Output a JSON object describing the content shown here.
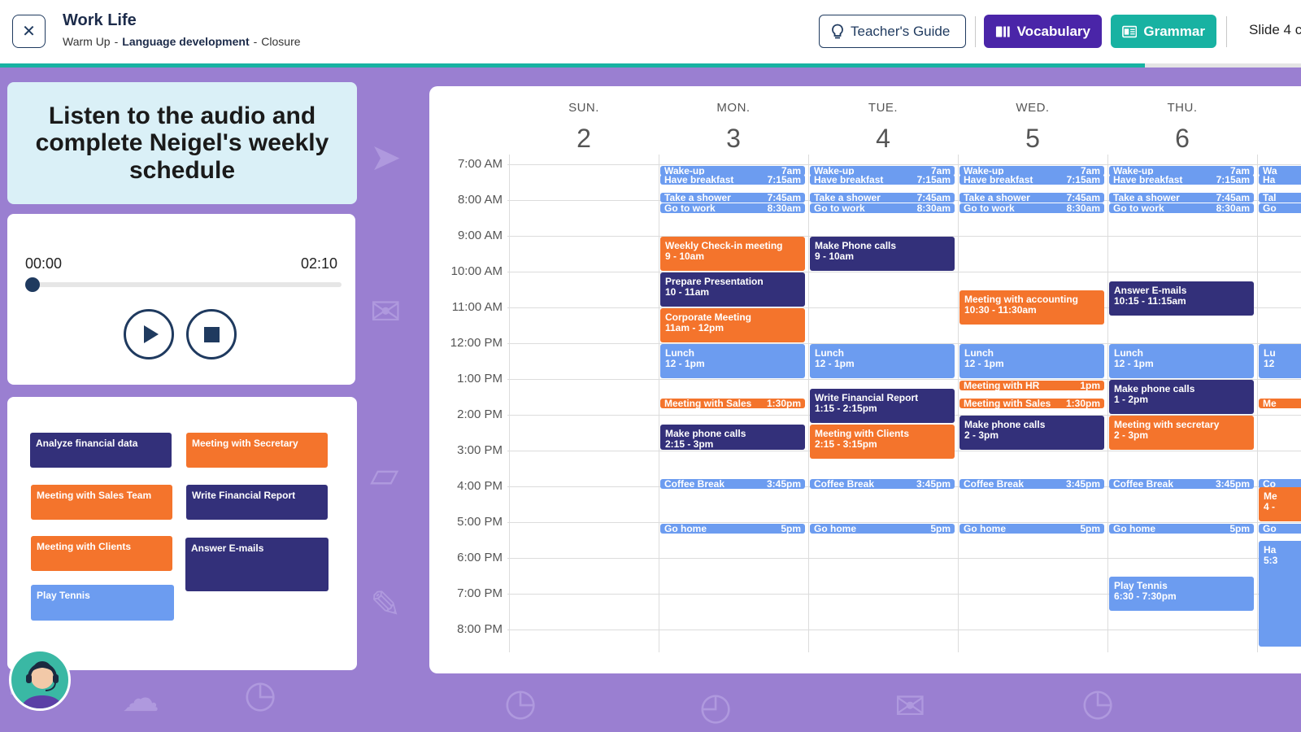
{
  "header": {
    "title": "Work Life",
    "breadcrumb": [
      "Warm Up",
      "Language development",
      "Closure"
    ],
    "teachers_guide_label": "Teacher's Guide",
    "vocabulary_label": "Vocabulary",
    "grammar_label": "Grammar",
    "slide_label": "Slide 4 c",
    "progress_fraction": 0.88
  },
  "instructions": "Listen to the audio and complete Neigel's weekly schedule",
  "player": {
    "current_time": "00:00",
    "total_time": "02:10"
  },
  "word_bank": [
    {
      "label": "Analyze financial data",
      "color": "navy"
    },
    {
      "label": "Meeting with Secretary",
      "color": "orange"
    },
    {
      "label": "Meeting with Sales Team",
      "color": "orange"
    },
    {
      "label": "Write Financial Report",
      "color": "navy"
    },
    {
      "label": "Meeting with Clients",
      "color": "orange"
    },
    {
      "label": "Answer E-mails",
      "color": "navy"
    },
    {
      "label": "Play Tennis",
      "color": "blue"
    }
  ],
  "calendar": {
    "days": [
      {
        "name": "SUN.",
        "date": "2"
      },
      {
        "name": "MON.",
        "date": "3"
      },
      {
        "name": "TUE.",
        "date": "4"
      },
      {
        "name": "WED.",
        "date": "5"
      },
      {
        "name": "THU.",
        "date": "6"
      },
      {
        "name": "",
        "date": ""
      }
    ],
    "hours": [
      "7:00 AM",
      "8:00 AM",
      "9:00 AM",
      "10:00 AM",
      "11:00 AM",
      "12:00 PM",
      "1:00 PM",
      "2:00 PM",
      "3:00 PM",
      "4:00 PM",
      "5:00 PM",
      "6:00 PM",
      "7:00 PM",
      "8:00 PM"
    ],
    "events": [
      {
        "day": 1,
        "title": "Wake-up",
        "time": "7am",
        "start": 7.0,
        "kind": "small",
        "color": "blue"
      },
      {
        "day": 1,
        "title": "Have breakfast",
        "time": "7:15am",
        "start": 7.25,
        "kind": "small",
        "color": "blue"
      },
      {
        "day": 1,
        "title": "Take a shower",
        "time": "7:45am",
        "start": 7.75,
        "kind": "small",
        "color": "blue"
      },
      {
        "day": 1,
        "title": "Go to work",
        "time": "8:30am",
        "start": 8.05,
        "kind": "small",
        "color": "blue"
      },
      {
        "day": 1,
        "title": "Weekly Check-in meeting",
        "time": "9 - 10am",
        "start": 9.0,
        "end": 10.0,
        "kind": "block",
        "color": "orange"
      },
      {
        "day": 1,
        "title": "Prepare Presentation",
        "time": "10 - 11am",
        "start": 10.0,
        "end": 11.0,
        "kind": "block",
        "color": "navy"
      },
      {
        "day": 1,
        "title": "Corporate Meeting",
        "time": "11am - 12pm",
        "start": 11.0,
        "end": 12.0,
        "kind": "block",
        "color": "orange"
      },
      {
        "day": 1,
        "title": "Lunch",
        "time": "12 - 1pm",
        "start": 12.0,
        "end": 13.0,
        "kind": "block",
        "color": "blue"
      },
      {
        "day": 1,
        "title": "Meeting with Sales",
        "time": "1:30pm",
        "start": 13.5,
        "kind": "small",
        "color": "orange"
      },
      {
        "day": 1,
        "title": "Make phone calls",
        "time": "2:15 - 3pm",
        "start": 14.25,
        "end": 15.0,
        "kind": "block",
        "color": "navy"
      },
      {
        "day": 1,
        "title": "Coffee Break",
        "time": "3:45pm",
        "start": 15.75,
        "kind": "small",
        "color": "blue"
      },
      {
        "day": 1,
        "title": "Go home",
        "time": "5pm",
        "start": 17.0,
        "kind": "small",
        "color": "blue"
      },
      {
        "day": 2,
        "title": "Wake-up",
        "time": "7am",
        "start": 7.0,
        "kind": "small",
        "color": "blue"
      },
      {
        "day": 2,
        "title": "Have breakfast",
        "time": "7:15am",
        "start": 7.25,
        "kind": "small",
        "color": "blue"
      },
      {
        "day": 2,
        "title": "Take a shower",
        "time": "7:45am",
        "start": 7.75,
        "kind": "small",
        "color": "blue"
      },
      {
        "day": 2,
        "title": "Go to work",
        "time": "8:30am",
        "start": 8.05,
        "kind": "small",
        "color": "blue"
      },
      {
        "day": 2,
        "title": "Make Phone calls",
        "time": "9 - 10am",
        "start": 9.0,
        "end": 10.0,
        "kind": "block",
        "color": "navy"
      },
      {
        "day": 2,
        "title": "Lunch",
        "time": "12 - 1pm",
        "start": 12.0,
        "end": 13.0,
        "kind": "block",
        "color": "blue"
      },
      {
        "day": 2,
        "title": "Write Financial Report",
        "time": "1:15 - 2:15pm",
        "start": 13.25,
        "end": 14.25,
        "kind": "block",
        "color": "navy"
      },
      {
        "day": 2,
        "title": "Meeting with Clients",
        "time": "2:15 - 3:15pm",
        "start": 14.25,
        "end": 15.25,
        "kind": "block",
        "color": "orange"
      },
      {
        "day": 2,
        "title": "Coffee Break",
        "time": "3:45pm",
        "start": 15.75,
        "kind": "small",
        "color": "blue"
      },
      {
        "day": 2,
        "title": "Go home",
        "time": "5pm",
        "start": 17.0,
        "kind": "small",
        "color": "blue"
      },
      {
        "day": 3,
        "title": "Wake-up",
        "time": "7am",
        "start": 7.0,
        "kind": "small",
        "color": "blue"
      },
      {
        "day": 3,
        "title": "Have breakfast",
        "time": "7:15am",
        "start": 7.25,
        "kind": "small",
        "color": "blue"
      },
      {
        "day": 3,
        "title": "Take a shower",
        "time": "7:45am",
        "start": 7.75,
        "kind": "small",
        "color": "blue"
      },
      {
        "day": 3,
        "title": "Go to work",
        "time": "8:30am",
        "start": 8.05,
        "kind": "small",
        "color": "blue"
      },
      {
        "day": 3,
        "title": "Meeting with accounting",
        "time": "10:30 - 11:30am",
        "start": 10.5,
        "end": 11.5,
        "kind": "block",
        "color": "orange"
      },
      {
        "day": 3,
        "title": "Lunch",
        "time": "12 - 1pm",
        "start": 12.0,
        "end": 13.0,
        "kind": "block",
        "color": "blue"
      },
      {
        "day": 3,
        "title": "Meeting with HR",
        "time": "1pm",
        "start": 13.0,
        "kind": "small",
        "color": "orange"
      },
      {
        "day": 3,
        "title": "Meeting with Sales",
        "time": "1:30pm",
        "start": 13.5,
        "kind": "small",
        "color": "orange"
      },
      {
        "day": 3,
        "title": "Make phone calls",
        "time": "2 - 3pm",
        "start": 14.0,
        "end": 15.0,
        "kind": "block",
        "color": "navy"
      },
      {
        "day": 3,
        "title": "Coffee Break",
        "time": "3:45pm",
        "start": 15.75,
        "kind": "small",
        "color": "blue"
      },
      {
        "day": 3,
        "title": "Go home",
        "time": "5pm",
        "start": 17.0,
        "kind": "small",
        "color": "blue"
      },
      {
        "day": 4,
        "title": "Wake-up",
        "time": "7am",
        "start": 7.0,
        "kind": "small",
        "color": "blue"
      },
      {
        "day": 4,
        "title": "Have breakfast",
        "time": "7:15am",
        "start": 7.25,
        "kind": "small",
        "color": "blue"
      },
      {
        "day": 4,
        "title": "Take a shower",
        "time": "7:45am",
        "start": 7.75,
        "kind": "small",
        "color": "blue"
      },
      {
        "day": 4,
        "title": "Go to work",
        "time": "8:30am",
        "start": 8.05,
        "kind": "small",
        "color": "blue"
      },
      {
        "day": 4,
        "title": "Answer E-mails",
        "time": "10:15 - 11:15am",
        "start": 10.25,
        "end": 11.25,
        "kind": "block",
        "color": "navy"
      },
      {
        "day": 4,
        "title": "Lunch",
        "time": "12 - 1pm",
        "start": 12.0,
        "end": 13.0,
        "kind": "block",
        "color": "blue"
      },
      {
        "day": 4,
        "title": "Make phone calls",
        "time": "1 - 2pm",
        "start": 13.0,
        "end": 14.0,
        "kind": "block",
        "color": "navy"
      },
      {
        "day": 4,
        "title": "Meeting with secretary",
        "time": "2 - 3pm",
        "start": 14.0,
        "end": 15.0,
        "kind": "block",
        "color": "orange"
      },
      {
        "day": 4,
        "title": "Coffee Break",
        "time": "3:45pm",
        "start": 15.75,
        "kind": "small",
        "color": "blue"
      },
      {
        "day": 4,
        "title": "Go home",
        "time": "5pm",
        "start": 17.0,
        "kind": "small",
        "color": "blue"
      },
      {
        "day": 4,
        "title": "Play Tennis",
        "time": "6:30 - 7:30pm",
        "start": 18.5,
        "end": 19.5,
        "kind": "block",
        "color": "blue"
      },
      {
        "day": 5,
        "title": "Wa",
        "time": "",
        "start": 7.0,
        "kind": "small",
        "color": "blue"
      },
      {
        "day": 5,
        "title": "Ha",
        "time": "",
        "start": 7.25,
        "kind": "small",
        "color": "blue"
      },
      {
        "day": 5,
        "title": "Tal",
        "time": "",
        "start": 7.75,
        "kind": "small",
        "color": "blue"
      },
      {
        "day": 5,
        "title": "Go",
        "time": "",
        "start": 8.05,
        "kind": "small",
        "color": "blue"
      },
      {
        "day": 5,
        "title": "Lu",
        "time": "12",
        "start": 12.0,
        "end": 13.0,
        "kind": "block",
        "color": "blue"
      },
      {
        "day": 5,
        "title": "Me",
        "time": "",
        "start": 13.5,
        "kind": "small",
        "color": "orange"
      },
      {
        "day": 5,
        "title": "Co",
        "time": "",
        "start": 15.75,
        "kind": "small",
        "color": "blue"
      },
      {
        "day": 5,
        "title": "Me",
        "time": "4 -",
        "start": 16.0,
        "end": 17.0,
        "kind": "block",
        "color": "orange"
      },
      {
        "day": 5,
        "title": "Go",
        "time": "",
        "start": 17.0,
        "kind": "small",
        "color": "blue"
      },
      {
        "day": 5,
        "title": "Ha",
        "time": "5:3",
        "start": 17.5,
        "end": 20.5,
        "kind": "block",
        "color": "blue"
      }
    ]
  }
}
